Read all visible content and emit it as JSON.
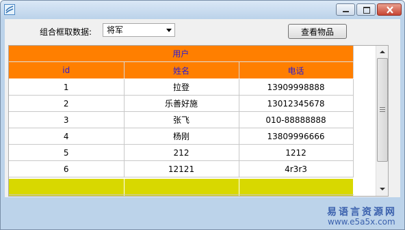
{
  "window": {
    "title": ""
  },
  "combo": {
    "label": "组合框取数据:",
    "value": "将军"
  },
  "toolbar": {
    "view_items_label": "查看物品"
  },
  "grid": {
    "title": "用户",
    "columns": [
      "id",
      "姓名",
      "电话"
    ],
    "rows": [
      [
        "1",
        "拉登",
        "13909998888"
      ],
      [
        "2",
        "乐善好施",
        "13012345678"
      ],
      [
        "3",
        "张飞",
        "010-88888888"
      ],
      [
        "4",
        "杨刚",
        "13809996666"
      ],
      [
        "5",
        "212",
        "1212"
      ],
      [
        "6",
        "12121",
        "4r3r3"
      ]
    ]
  },
  "watermark": {
    "site_name": "易语言资源网",
    "url": "www.e5a5x.com"
  },
  "colors": {
    "header_bg": "#ff7f00",
    "header_text": "#2b1bd4",
    "highlight_row": "#d8d800"
  }
}
